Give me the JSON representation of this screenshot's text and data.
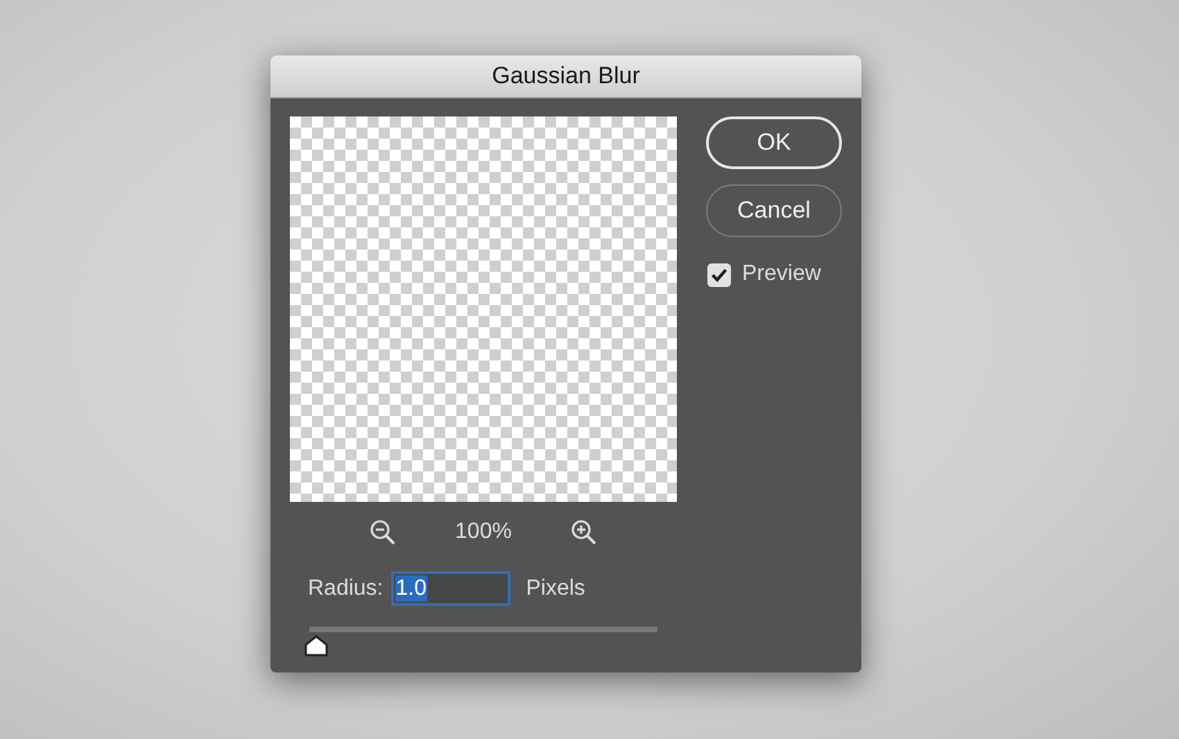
{
  "window": {
    "title": "Gaussian Blur"
  },
  "preview": {
    "zoom": "100%"
  },
  "buttons": [
    {
      "label": "OK",
      "default": true
    },
    {
      "label": "Cancel",
      "default": false
    }
  ],
  "preview_checkbox": {
    "label": "Preview",
    "checked": true
  },
  "radius": {
    "label": "Radius:",
    "value": "1.0",
    "value_selected": true,
    "unit": "Pixels"
  },
  "slider": {
    "level": 0.02
  }
}
